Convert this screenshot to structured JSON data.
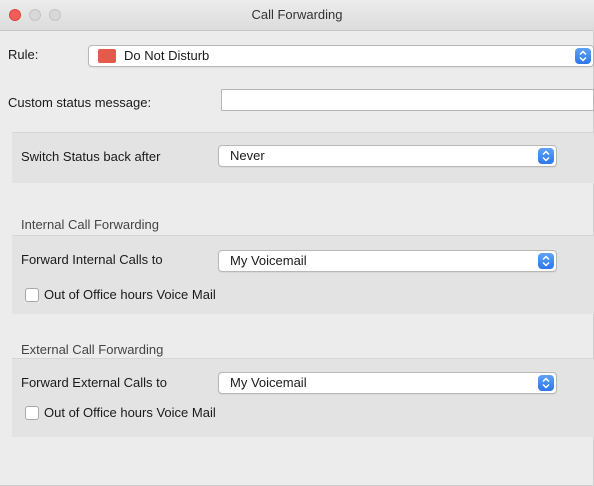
{
  "window": {
    "title": "Call Forwarding"
  },
  "rule": {
    "label": "Rule:",
    "value": "Do Not Disturb",
    "swatch_color": "#e35c4b",
    "icon": "updown-stepper-icon"
  },
  "custom_status": {
    "label": "Custom status message:",
    "value": ""
  },
  "switch_status": {
    "label": "Switch Status back after",
    "value": "Never"
  },
  "internal": {
    "section_label": "Internal Call Forwarding",
    "forward_label": "Forward Internal Calls to",
    "forward_value": "My Voicemail",
    "checkbox_label": "Out of Office hours Voice Mail",
    "checked": false
  },
  "external": {
    "section_label": "External Call Forwarding",
    "forward_label": "Forward External Calls to",
    "forward_value": "My Voicemail",
    "checkbox_label": "Out of Office hours Voice Mail",
    "checked": false
  },
  "colors": {
    "accent": "#2d76ea",
    "close": "#f25e57",
    "panel": "#e3e3e3"
  }
}
